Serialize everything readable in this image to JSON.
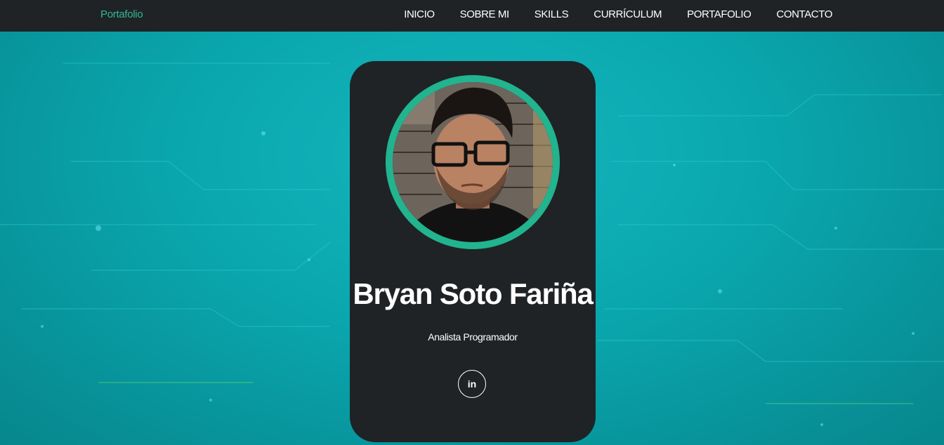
{
  "navbar": {
    "brand": "Portafolio",
    "links": [
      {
        "label": "INICIO"
      },
      {
        "label": "SOBRE MI"
      },
      {
        "label": "SKILLS"
      },
      {
        "label": "CURRÍCULUM"
      },
      {
        "label": "PORTAFOLIO"
      },
      {
        "label": "CONTACTO"
      }
    ]
  },
  "profile": {
    "name": "Bryan Soto Fariña",
    "role": "Analista Programador",
    "photo_icon": "profile-photo",
    "social": [
      {
        "icon": "linkedin-icon",
        "glyph": "in"
      }
    ]
  },
  "colors": {
    "accent": "#2fb894",
    "ring": "#22b38f",
    "dark": "#1f2326",
    "background": "#0aa6ad"
  }
}
